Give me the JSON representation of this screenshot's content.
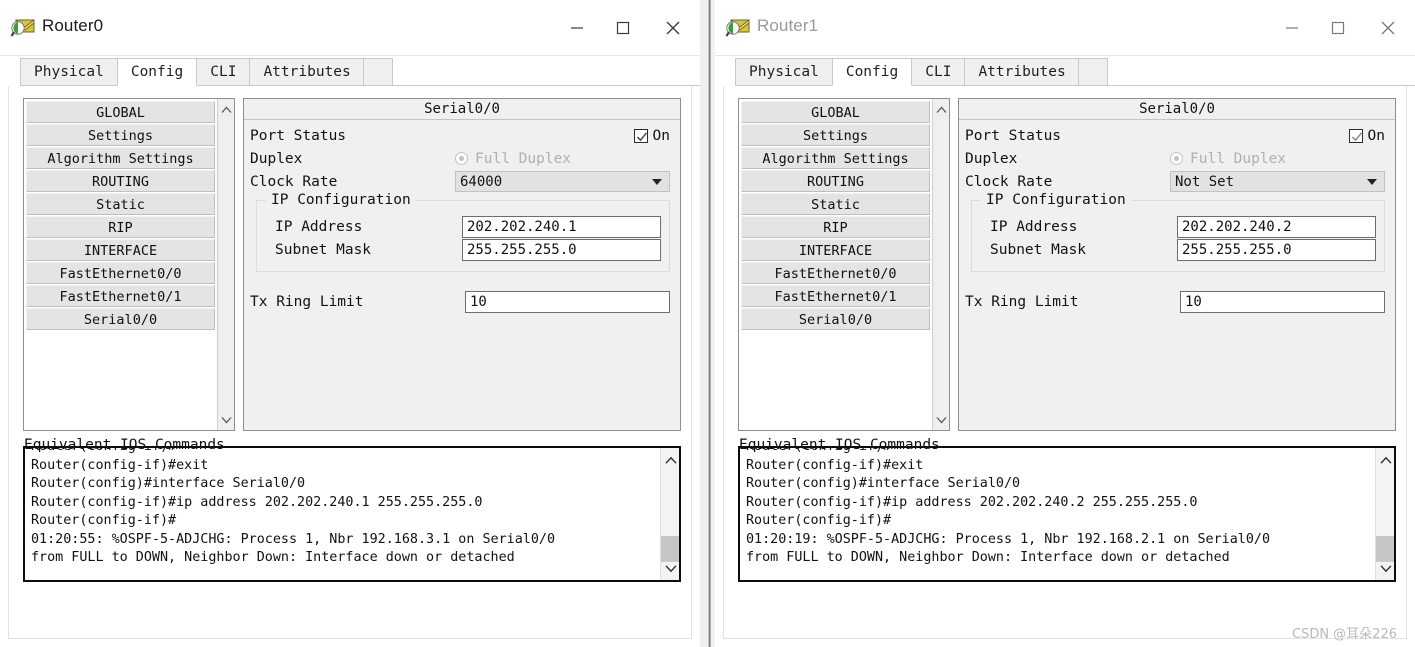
{
  "app": {
    "icon": "packet-tracer-icon",
    "watermark": "CSDN @耳朵226"
  },
  "window_controls": {
    "minimize": "—",
    "maximize": "□",
    "close": "✕"
  },
  "tabs": [
    "Physical",
    "Config",
    "CLI",
    "Attributes"
  ],
  "sidebar_items": [
    "GLOBAL",
    "Settings",
    "Algorithm Settings",
    "ROUTING",
    "Static",
    "RIP",
    "INTERFACE",
    "FastEthernet0/0",
    "FastEthernet0/1",
    "Serial0/0"
  ],
  "labels": {
    "port_status": "Port Status",
    "port_status_value": "On",
    "duplex": "Duplex",
    "duplex_value": "Full Duplex",
    "clock_rate": "Clock Rate",
    "ip_configuration": "IP Configuration",
    "ip_address": "IP Address",
    "subnet_mask": "Subnet Mask",
    "tx_ring_limit": "Tx Ring Limit",
    "ios_commands": "Equivalent IOS Commands"
  },
  "windows": [
    {
      "id": "router0",
      "title": "Router0",
      "active": true,
      "active_tab": "Config",
      "panel_title": "Serial0/0",
      "clock_rate": "64000",
      "ip_address": "202.202.240.1",
      "subnet_mask": "255.255.255.0",
      "tx_ring_limit": "10",
      "ios_text": "Router(config-if)#\nRouter(config-if)#exit\nRouter(config)#interface Serial0/0\nRouter(config-if)#ip address 202.202.240.1 255.255.255.0\nRouter(config-if)#\n01:20:55: %OSPF-5-ADJCHG: Process 1, Nbr 192.168.3.1 on Serial0/0\nfrom FULL to DOWN, Neighbor Down: Interface down or detached"
    },
    {
      "id": "router1",
      "title": "Router1",
      "active": false,
      "active_tab": "Config",
      "panel_title": "Serial0/0",
      "clock_rate": "Not Set",
      "ip_address": "202.202.240.2",
      "subnet_mask": "255.255.255.0",
      "tx_ring_limit": "10",
      "ios_text": "Router(config-if)#\nRouter(config-if)#exit\nRouter(config)#interface Serial0/0\nRouter(config-if)#ip address 202.202.240.2 255.255.255.0\nRouter(config-if)#\n01:20:19: %OSPF-5-ADJCHG: Process 1, Nbr 192.168.2.1 on Serial0/0\nfrom FULL to DOWN, Neighbor Down: Interface down or detached"
    }
  ]
}
